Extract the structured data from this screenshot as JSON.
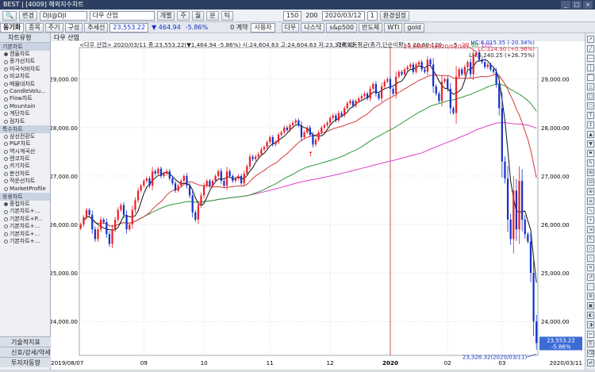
{
  "window": {
    "title": "BEST | [4009] 해외지수차트",
    "buttons": [
      "_",
      "□",
      "×"
    ]
  },
  "toolbar1": {
    "search_label": "변경",
    "symbol_code": "DJI@DJI",
    "symbol_name": "다우 산업",
    "period_buttons": [
      "개별",
      "주",
      "월",
      "분",
      "틱"
    ],
    "count_value": "150",
    "count_total": "200",
    "date_value": "2020/03/12",
    "step_value": "1",
    "settings_label": "환경설정"
  },
  "toolbar2": {
    "tabs": [
      "동기화",
      "종목",
      "주기",
      "구성",
      "추세선"
    ],
    "price": "23,553.22",
    "change": "▼ 464.94",
    "change_pct": "-5.86%",
    "volume": "0 계약",
    "user_label": "사용자",
    "quick_links": [
      "다우",
      "나스닥",
      "s&p500",
      "반도체",
      "WTI",
      "gold"
    ]
  },
  "sidebar": {
    "header": "차트유형",
    "groups": [
      {
        "label": "기본차트",
        "items": [
          {
            "label": "캔들차트",
            "selected": true
          },
          {
            "label": "종가선차트",
            "selected": false
          },
          {
            "label": "미국식바차트",
            "selected": false
          },
          {
            "label": "비교차트",
            "selected": false
          },
          {
            "label": "매물대차트",
            "selected": false
          },
          {
            "label": "CandleVolu...",
            "selected": false
          },
          {
            "label": "Flow차트",
            "selected": false
          },
          {
            "label": "Mountain",
            "selected": false
          },
          {
            "label": "계단차트",
            "selected": false
          },
          {
            "label": "점차트",
            "selected": false
          }
        ]
      },
      {
        "label": "특수차트",
        "items": [
          {
            "label": "삼선전환도",
            "selected": false
          },
          {
            "label": "P&F차트",
            "selected": false
          },
          {
            "label": "역시계곡선",
            "selected": false
          },
          {
            "label": "렌코차트",
            "selected": false
          },
          {
            "label": "카기차트",
            "selected": false
          },
          {
            "label": "분산차트",
            "selected": false
          },
          {
            "label": "적운선차트",
            "selected": false
          },
          {
            "label": "MarketProfile",
            "selected": false
          }
        ]
      },
      {
        "label": "응용차트",
        "items": [
          {
            "label": "중첩차트",
            "selected": true
          },
          {
            "label": "기본차트+...",
            "selected": false
          },
          {
            "label": "기본차트+P...",
            "selected": false
          },
          {
            "label": "기본차트+...",
            "selected": false
          },
          {
            "label": "기본차트+...",
            "selected": false
          },
          {
            "label": "기본차트+...",
            "selected": false
          }
        ]
      }
    ],
    "bottom_tabs": [
      "기술적지표",
      "신호/강세/약세",
      "투자자동향"
    ]
  },
  "chart_header": {
    "tab": "다우 산업",
    "info_line": "<다우 산업> 2020/03/11 종:23,553.22(▼1,464.94 -5.86%) 시:24,604.63 고:24,604.63 저:23,328.32",
    "ma_label": "가격이동평균(종가,단순이평) 5 20 60 120",
    "hc": "HC:6,015.35 (-20.34%)",
    "lc": "LC:224.90 (+0.96%)",
    "lh": "LH:6,240.25 (+26.75%)"
  },
  "annotations": {
    "high": "29,568.57(2020/02/12)",
    "low": "23,328.32(2020/03/11)",
    "last_price": "23,553.22",
    "last_pct": "-5.86%"
  },
  "colors": {
    "up": "#e8202a",
    "down": "#1532c8",
    "ma5": "#111111",
    "ma20": "#d43a3a",
    "ma60": "#2e9a3a",
    "ma120": "#e040c8",
    "vline": "#c03030",
    "grid": "#c9ced6"
  },
  "chart_data": {
    "type": "candlestick",
    "ylim": [
      23300,
      29650
    ],
    "y_ticks": [
      "24,000.00",
      "25,000.00",
      "26,000.00",
      "27,000.00",
      "28,000.00",
      "29,000.00"
    ],
    "y_tick_values": [
      24000,
      25000,
      26000,
      27000,
      28000,
      29000
    ],
    "x_ticks": [
      "2019/08/07",
      "09",
      "10",
      "11",
      "12",
      "2020",
      "02",
      "03",
      "2020/03/11"
    ],
    "x_tick_index": [
      0,
      22,
      43,
      66,
      87,
      108,
      128,
      147,
      158
    ],
    "close": [
      26000,
      26150,
      26300,
      26200,
      25900,
      25700,
      25900,
      26100,
      26050,
      25800,
      25600,
      25900,
      26100,
      26300,
      26400,
      26200,
      25900,
      26000,
      26300,
      26500,
      26700,
      26800,
      26900,
      26950,
      26800,
      27100,
      27050,
      27150,
      27000,
      27050,
      27100,
      26950,
      26850,
      26700,
      26800,
      26900,
      27000,
      26800,
      26600,
      26250,
      26100,
      26400,
      26600,
      26800,
      26900,
      26800,
      26900,
      27000,
      27100,
      26900,
      26800,
      27100,
      27000,
      26900,
      26950,
      27000,
      26850,
      27050,
      27200,
      27400,
      27350,
      27400,
      27450,
      27550,
      27600,
      27700,
      27800,
      27650,
      27700,
      27850,
      27900,
      28000,
      27950,
      28050,
      28100,
      28150,
      28050,
      27800,
      27900,
      28000,
      27850,
      27650,
      27750,
      27900,
      28000,
      28050,
      28100,
      28200,
      28250,
      28150,
      28300,
      28250,
      28400,
      28500,
      28550,
      28450,
      28550,
      28600,
      28650,
      28700,
      28600,
      28800,
      28900,
      28700,
      28600,
      28850,
      28950,
      29000,
      28800,
      28700,
      29050,
      29150,
      29100,
      29200,
      29250,
      29300,
      29150,
      29300,
      29350,
      29200,
      29150,
      29400,
      29300,
      28850,
      28700,
      28550,
      28950,
      29000,
      28800,
      28400,
      28300,
      29050,
      29200,
      29100,
      29250,
      29350,
      29100,
      29500,
      29550,
      29400,
      29350,
      29250,
      29300,
      29200,
      29150,
      28900,
      28400,
      27300,
      26950,
      26100,
      25700,
      26700,
      25900,
      26900,
      26100,
      25800,
      25650,
      25000,
      24000,
      23553
    ]
  }
}
